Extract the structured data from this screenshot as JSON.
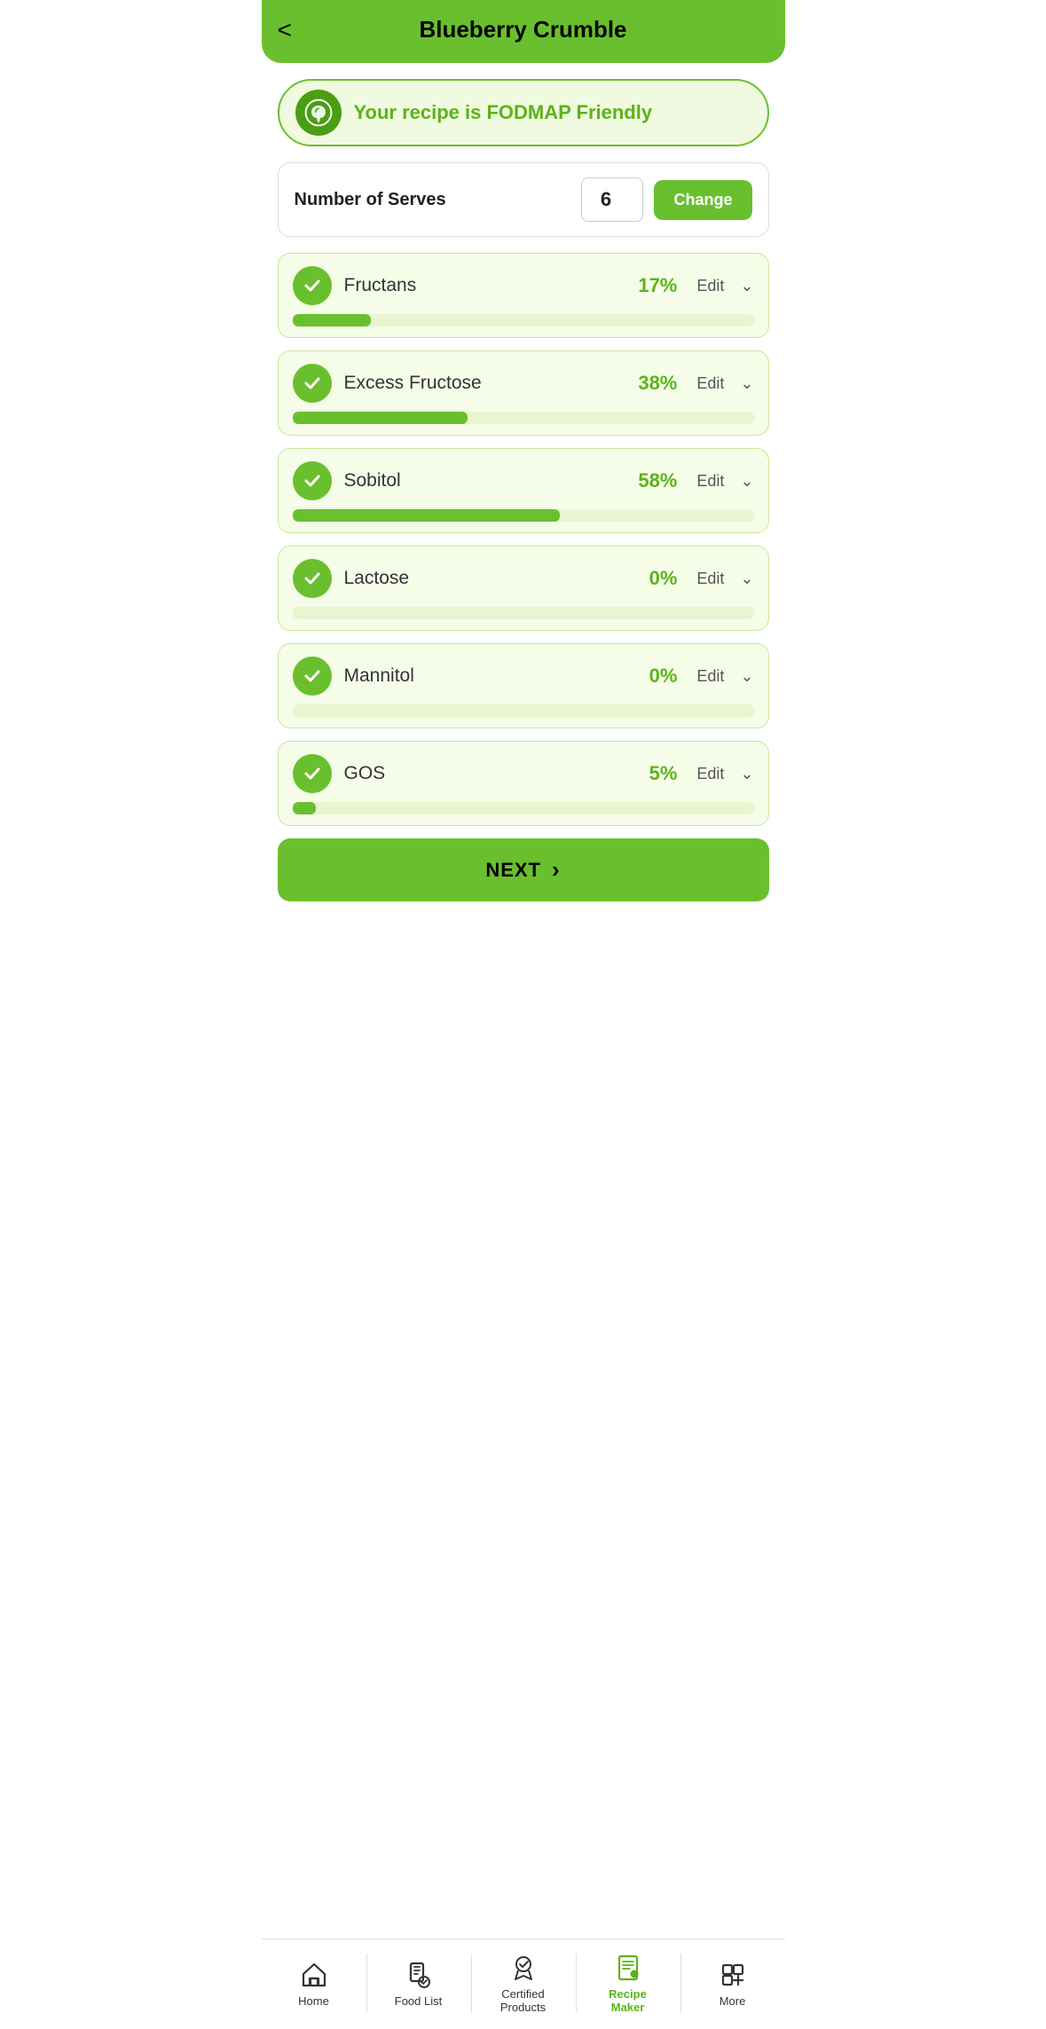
{
  "header": {
    "back_label": "<",
    "title": "Blueberry Crumble"
  },
  "fodmap_banner": {
    "text": "Your recipe is FODMAP Friendly"
  },
  "serves": {
    "label": "Number of Serves",
    "value": "6",
    "change_btn": "Change"
  },
  "fodmap_items": [
    {
      "name": "Fructans",
      "percent": "17%",
      "percent_num": 17,
      "edit": "Edit"
    },
    {
      "name": "Excess Fructose",
      "percent": "38%",
      "percent_num": 38,
      "edit": "Edit"
    },
    {
      "name": "Sobitol",
      "percent": "58%",
      "percent_num": 58,
      "edit": "Edit"
    },
    {
      "name": "Lactose",
      "percent": "0%",
      "percent_num": 0,
      "edit": "Edit"
    },
    {
      "name": "Mannitol",
      "percent": "0%",
      "percent_num": 0,
      "edit": "Edit"
    },
    {
      "name": "GOS",
      "percent": "5%",
      "percent_num": 5,
      "edit": "Edit"
    }
  ],
  "next_btn": "NEXT",
  "nav": {
    "items": [
      {
        "id": "home",
        "label": "Home",
        "active": false
      },
      {
        "id": "food-list",
        "label": "Food List",
        "active": false
      },
      {
        "id": "certified-products",
        "label": "Certified Products",
        "active": false
      },
      {
        "id": "recipe-maker",
        "label": "Recipe Maker",
        "active": true
      },
      {
        "id": "more",
        "label": "More",
        "active": false
      }
    ]
  },
  "colors": {
    "green": "#6abf2e",
    "green_dark": "#4a9e12",
    "green_text": "#5cb319"
  }
}
